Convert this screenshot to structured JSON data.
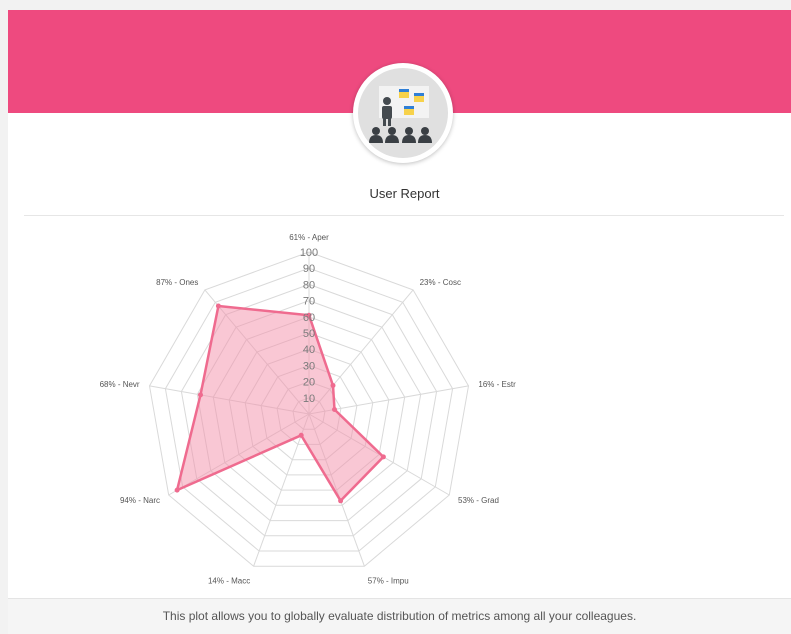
{
  "report": {
    "title": "User Report",
    "footer_text": "This plot allows you to globally evaluate distribution of metrics among all your colleagues."
  },
  "colors": {
    "banner": "#ee4a7f",
    "series_stroke": "#ef6b8f",
    "series_fill": "rgba(244,143,170,0.5)",
    "grid": "#d9d9d9"
  },
  "avatar_icon": "presentation-audience-icon",
  "chart_data": {
    "type": "radar",
    "r_range": [
      0,
      100
    ],
    "r_ticks": [
      10,
      20,
      30,
      40,
      50,
      60,
      70,
      80,
      90,
      100
    ],
    "grid": true,
    "categories": [
      "Aper",
      "Cosc",
      "Estr",
      "Grad",
      "Impu",
      "Macc",
      "Narc",
      "Nevr",
      "Ones"
    ],
    "values": [
      61,
      23,
      16,
      53,
      57,
      14,
      94,
      68,
      87
    ],
    "labels": [
      "61% - Aper",
      "23% - Cosc",
      "16% - Estr",
      "53% - Grad",
      "57% - Impu",
      "14% - Macc",
      "94% - Narc",
      "68% - Nevr",
      "87% - Ones"
    ]
  }
}
